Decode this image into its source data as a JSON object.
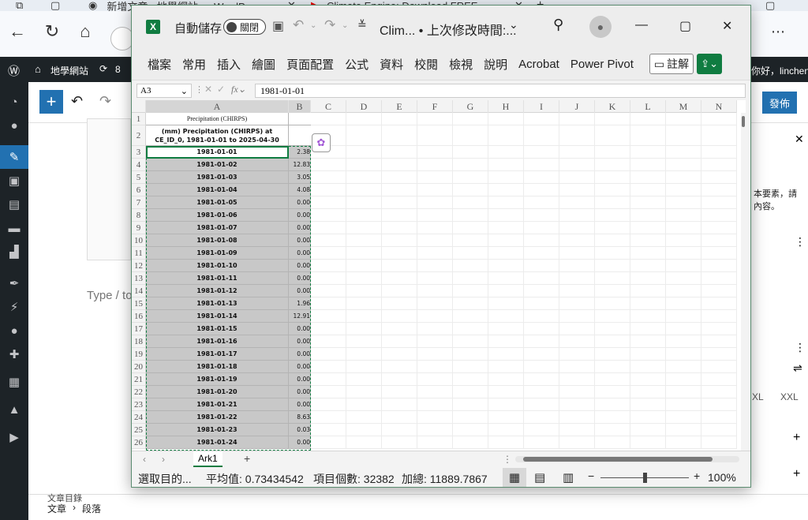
{
  "browser": {
    "tabs": [
      {
        "label": "新增文章 ‹ 地學網站 — WordPress"
      },
      {
        "label": "Climate Engine: Download FREE"
      }
    ],
    "new_tab_label": "+"
  },
  "wordpress": {
    "site_name": "地學網站",
    "update_count": "8",
    "greeting": "你好，linchenw",
    "publish_label": "發佈",
    "placeholder_text": "Type / to choose a block",
    "right_panel_text": "本要素，請\n內容。",
    "size_options": [
      "XL",
      "XXL"
    ],
    "breadcrumb": [
      "文章",
      "段落"
    ],
    "footer_section": "文章目錄"
  },
  "excel": {
    "autosave_label": "自動儲存",
    "autosave_state": "關閉",
    "file_title": "Clim... • 上次修改時間:...",
    "menu": [
      "檔案",
      "常用",
      "插入",
      "繪圖",
      "頁面配置",
      "公式",
      "資料",
      "校閱",
      "檢視",
      "說明",
      "Acrobat",
      "Power Pivot"
    ],
    "comment_label": "註解",
    "name_box": "A3",
    "formula_value": "1981-01-01",
    "columns": [
      "A",
      "B",
      "C",
      "D",
      "E",
      "F",
      "G",
      "H",
      "I",
      "J",
      "K",
      "L",
      "M",
      "N"
    ],
    "cell_a1": "Precipitation (CHIRPS)",
    "cell_a2": "(mm) Precipitation (CHIRPS) at CE_ID_0, 1981-01-01 to 2025-04-30",
    "rows": [
      {
        "n": "1"
      },
      {
        "n": "2"
      },
      {
        "n": "3",
        "date": "1981-01-01",
        "value": "2.38"
      },
      {
        "n": "4",
        "date": "1981-01-02",
        "value": "12.83"
      },
      {
        "n": "5",
        "date": "1981-01-03",
        "value": "3.05"
      },
      {
        "n": "6",
        "date": "1981-01-04",
        "value": "4.08"
      },
      {
        "n": "7",
        "date": "1981-01-05",
        "value": "0.00"
      },
      {
        "n": "8",
        "date": "1981-01-06",
        "value": "0.00"
      },
      {
        "n": "9",
        "date": "1981-01-07",
        "value": "0.00"
      },
      {
        "n": "10",
        "date": "1981-01-08",
        "value": "0.00"
      },
      {
        "n": "11",
        "date": "1981-01-09",
        "value": "0.00"
      },
      {
        "n": "12",
        "date": "1981-01-10",
        "value": "0.00"
      },
      {
        "n": "13",
        "date": "1981-01-11",
        "value": "0.00"
      },
      {
        "n": "14",
        "date": "1981-01-12",
        "value": "0.00"
      },
      {
        "n": "15",
        "date": "1981-01-13",
        "value": "1.96"
      },
      {
        "n": "16",
        "date": "1981-01-14",
        "value": "12.91"
      },
      {
        "n": "17",
        "date": "1981-01-15",
        "value": "0.00"
      },
      {
        "n": "18",
        "date": "1981-01-16",
        "value": "0.00"
      },
      {
        "n": "19",
        "date": "1981-01-17",
        "value": "0.00"
      },
      {
        "n": "20",
        "date": "1981-01-18",
        "value": "0.00"
      },
      {
        "n": "21",
        "date": "1981-01-19",
        "value": "0.00"
      },
      {
        "n": "22",
        "date": "1981-01-20",
        "value": "0.00"
      },
      {
        "n": "23",
        "date": "1981-01-21",
        "value": "0.00"
      },
      {
        "n": "24",
        "date": "1981-01-22",
        "value": "8.63"
      },
      {
        "n": "25",
        "date": "1981-01-23",
        "value": "0.03"
      },
      {
        "n": "26",
        "date": "1981-01-24",
        "value": "0.00"
      }
    ],
    "sheet_tab": "Ark1",
    "add_sheet": "+",
    "status": {
      "mode": "選取目的...",
      "average": "平均值: 0.73434542",
      "count": "項目個數: 32382",
      "sum": "加總: 11889.7867",
      "zoom": "100%",
      "zoom_level_fraction": 0.5
    },
    "accent_color": "#107c41"
  }
}
